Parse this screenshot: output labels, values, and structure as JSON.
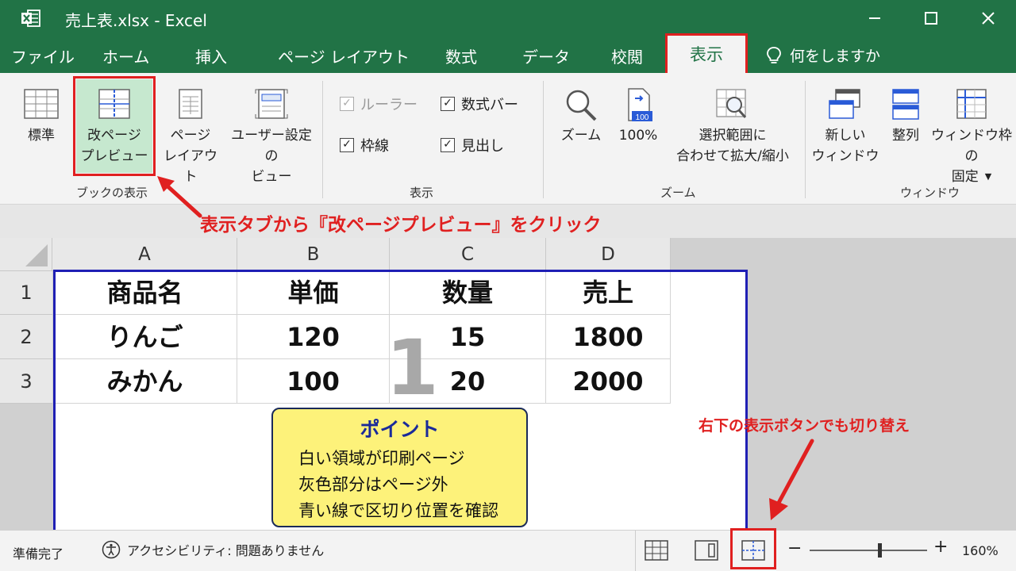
{
  "window": {
    "title": "売上表.xlsx  -  Excel"
  },
  "tabs": [
    "ファイル",
    "ホーム",
    "挿入",
    "ページ レイアウト",
    "数式",
    "データ",
    "校閲"
  ],
  "active_tab": "表示",
  "tell_me": "何をしますか",
  "ribbon": {
    "book_view": {
      "normal": "標準",
      "page_break_1": "改ページ",
      "page_break_2": "プレビュー",
      "page_layout_1": "ページ",
      "page_layout_2": "レイアウト",
      "custom_1": "ユーザー設定の",
      "custom_2": "ビュー",
      "label": "ブックの表示"
    },
    "show": {
      "ruler": "ルーラー",
      "formula_bar": "数式バー",
      "gridlines": "枠線",
      "headings": "見出し",
      "label": "表示"
    },
    "zoom": {
      "zoom": "ズーム",
      "zoom100": "100%",
      "zoom100_icon_text": "100",
      "zoom_sel_1": "選択範囲に",
      "zoom_sel_2": "合わせて拡大/縮小",
      "label": "ズーム"
    },
    "window": {
      "new_1": "新しい",
      "new_2": "ウィンドウ",
      "arrange": "整列",
      "freeze_1": "ウィンドウ枠の",
      "freeze_2": "固定",
      "label": "ウィンドウ"
    }
  },
  "annotations": {
    "top": "表示タブから『改ページプレビュー』をクリック",
    "right": "右下の表示ボタンでも切り替え"
  },
  "sheet": {
    "columns": [
      "A",
      "B",
      "C",
      "D"
    ],
    "rows": [
      "1",
      "2",
      "3"
    ],
    "cells": [
      [
        "商品名",
        "単価",
        "数量",
        "売上"
      ],
      [
        "りんご",
        "120",
        "15",
        "1800"
      ],
      [
        "みかん",
        "100",
        "20",
        "2000"
      ]
    ],
    "page_number": "1"
  },
  "point": {
    "title": "ポイント",
    "lines": [
      "白い領域が印刷ページ",
      "灰色部分はページ外",
      "青い線で区切り位置を確認"
    ]
  },
  "status": {
    "ready": "準備完了",
    "accessibility": "アクセシビリティ: 問題ありません",
    "zoom": "160%",
    "zoom_fraction": 0.6
  },
  "colors": {
    "excel_green": "#217346",
    "highlight_red": "#e02020",
    "page_break_blue": "#1f1fb4",
    "point_yellow": "#fdf27a"
  }
}
